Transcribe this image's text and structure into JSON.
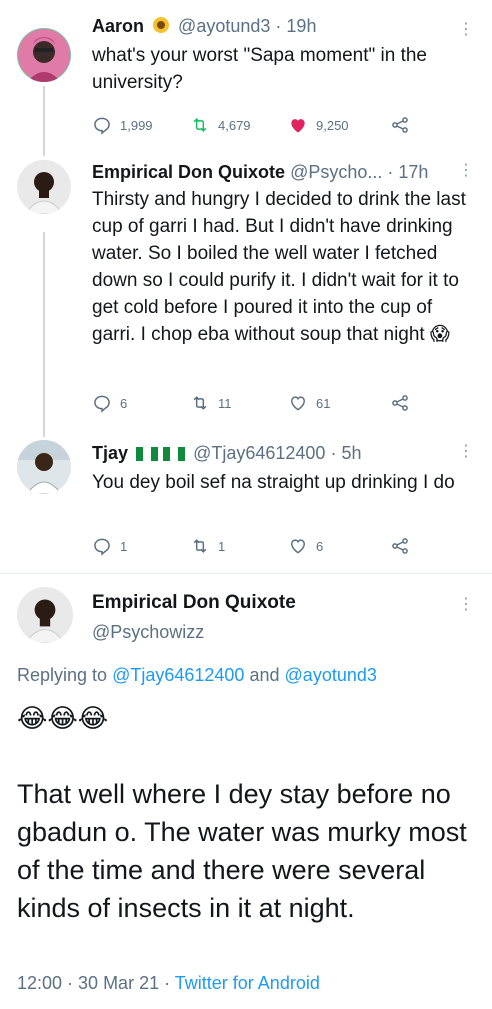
{
  "tweets": [
    {
      "name": "Aaron",
      "handle": "@ayotund3",
      "time": "19h",
      "text": "what's your worst \"Sapa moment\" in the university?",
      "replies": "1,999",
      "retweets": "4,679",
      "likes": "9,250",
      "liked": true
    },
    {
      "name": "Empirical Don Quixote",
      "handle": "@Psycho...",
      "time": "17h",
      "text": "Thirsty and hungry I decided to drink the last cup of garri I had. But I didn't have drinking water. So I boiled the well water I fetched down so I could purify it. I didn't wait for it to get cold before I poured it into the cup of garri. I chop eba without soup that night 😱",
      "replies": "6",
      "retweets": "11",
      "likes": "61"
    },
    {
      "name": "Tjay",
      "handle": "@Tjay64612400",
      "time": "5h",
      "text": "You dey boil sef na straight up drinking I do",
      "replies": "1",
      "retweets": "1",
      "likes": "6"
    }
  ],
  "main": {
    "name": "Empirical Don Quixote",
    "handle": "@Psychowizz",
    "replying_prefix": "Replying to",
    "replying_to_1": "@Tjay64612400",
    "replying_and": "and",
    "replying_to_2": "@ayotund3",
    "emoji_line": "😂😂😂",
    "text": "That well where I dey stay before no gbadun o. The water was murky most of the time and there were several kinds of insects in it at night.",
    "timestamp": "12:00 · 30 Mar 21",
    "source": "Twitter for Android"
  },
  "colors": {
    "link": "#1d9bf0",
    "like_active": "#e0245e",
    "retweet": "#17bf63",
    "secondary": "#5b7083"
  },
  "icons": [
    "reply-icon",
    "retweet-icon",
    "like-icon",
    "share-icon",
    "more-icon",
    "sunflower-icon",
    "flag-icon"
  ]
}
